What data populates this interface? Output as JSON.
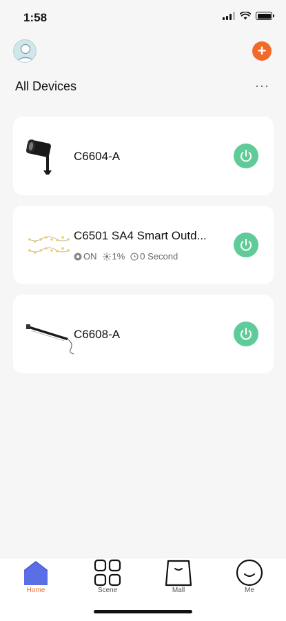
{
  "status_bar": {
    "time": "1:58"
  },
  "header": {
    "add_label": "+",
    "more_label": "···"
  },
  "section": {
    "title": "All Devices"
  },
  "devices": [
    {
      "name": "C6604-A",
      "icon": "spotlight-icon",
      "power": "on"
    },
    {
      "name": "C6501 SA4 Smart Outd...",
      "icon": "string-lights-icon",
      "power": "on",
      "status": {
        "state": "ON",
        "brightness": "1%",
        "timer": "0 Second"
      }
    },
    {
      "name": "C6608-A",
      "icon": "wall-light-bar-icon",
      "power": "on"
    }
  ],
  "tabs": [
    {
      "label": "Home",
      "icon": "home-icon",
      "active": true
    },
    {
      "label": "Scene",
      "icon": "grid-icon",
      "active": false
    },
    {
      "label": "Mall",
      "icon": "bag-icon",
      "active": false
    },
    {
      "label": "Me",
      "icon": "smiley-icon",
      "active": false
    }
  ],
  "colors": {
    "accent": "#f26a2a",
    "power": "#5fcb98",
    "home_tab": "#5a6ee6",
    "background": "#f6f6f6"
  }
}
